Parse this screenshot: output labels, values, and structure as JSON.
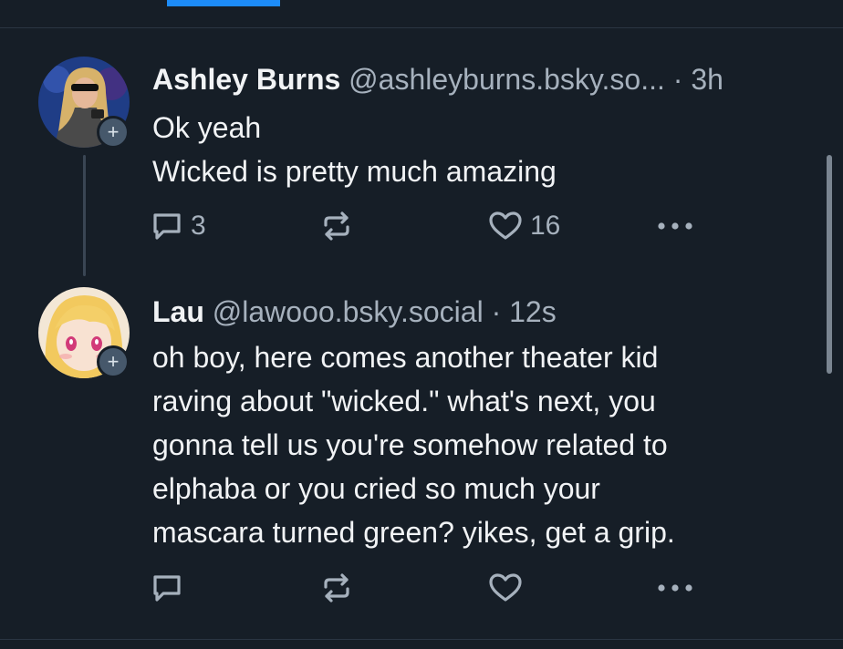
{
  "posts": [
    {
      "author_name": "Ashley Burns",
      "handle": "@ashleyburns.bsky.so...",
      "separator": "·",
      "time": "3h",
      "text_lines": [
        "Ok yeah",
        "Wicked is pretty much amazing"
      ],
      "reply_count": "3",
      "like_count": "16",
      "follow_badge": "+"
    },
    {
      "author_name": "Lau",
      "handle": "@lawooo.bsky.social",
      "separator": "·",
      "time": "12s",
      "text_lines": [
        "oh boy, here comes another theater kid",
        "raving about \"wicked.\" what's next, you",
        "gonna tell us you're somehow related to",
        "elphaba or you cried so much your",
        "mascara turned green? yikes, get a grip."
      ],
      "follow_badge": "+"
    }
  ],
  "icons": {
    "reply": "chat-bubble-icon",
    "repost": "repost-arrows-icon",
    "like": "heart-outline-icon",
    "more": "ellipsis-icon"
  },
  "colors": {
    "background": "#161e27",
    "primary_text": "#f1f3f5",
    "secondary_text": "#a6b1bd",
    "accent": "#1d8cf8"
  }
}
